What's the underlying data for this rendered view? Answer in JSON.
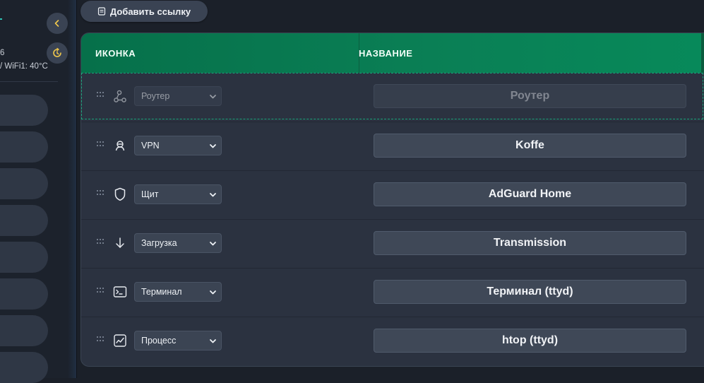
{
  "sidebar": {
    "stat_partial": "6",
    "temp_text": "/ WiFi1: 40°C",
    "accent_color": "#2ec4b6",
    "collapse_icon": "chevron-left-icon",
    "refresh_icon": "refresh-icon"
  },
  "toolbar": {
    "add_link_label": "Добавить ссылку",
    "add_link_icon": "document-icon"
  },
  "table": {
    "headers": {
      "icon": "ИКОНКА",
      "name": "НАЗВАНИЕ"
    },
    "header_color": "#07744d",
    "rows": [
      {
        "icon": "router-icon",
        "icon_select": "Роутер",
        "name": "Роутер",
        "dragging": true
      },
      {
        "icon": "vpn-icon",
        "icon_select": "VPN",
        "name": "Koffe"
      },
      {
        "icon": "shield-icon",
        "icon_select": "Щит",
        "name": "AdGuard Home"
      },
      {
        "icon": "download-icon",
        "icon_select": "Загрузка",
        "name": "Transmission"
      },
      {
        "icon": "terminal-icon",
        "icon_select": "Терминал",
        "name": "Терминал (ttyd)"
      },
      {
        "icon": "activity-icon",
        "icon_select": "Процесс",
        "name": "htop (ttyd)"
      }
    ]
  }
}
